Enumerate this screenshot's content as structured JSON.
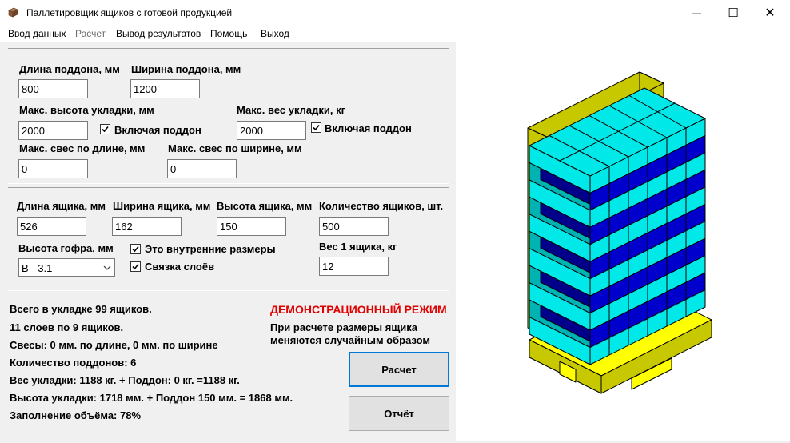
{
  "window": {
    "title": "Паллетировщик ящиков с готовой продукцией",
    "minimize_glyph": "—",
    "maximize_glyph": "☐",
    "close_glyph": "✕"
  },
  "menu": {
    "items": [
      "Ввод данных",
      "Расчет",
      "Вывод результатов",
      "Помощь",
      "Выход"
    ]
  },
  "pallet": {
    "length_label": "Длина поддона, мм",
    "length_value": "800",
    "width_label": "Ширина поддона, мм",
    "width_value": "1200",
    "max_height_label": "Макс. высота укладки, мм",
    "max_height_value": "2000",
    "height_incl_pallet_label": "Включая поддон",
    "height_incl_pallet_checked": true,
    "max_weight_label": "Макс. вес укладки, кг",
    "max_weight_value": "2000",
    "weight_incl_pallet_label": "Включая поддон",
    "weight_incl_pallet_checked": true,
    "overhang_length_label": "Макс. свес по длине, мм",
    "overhang_length_value": "0",
    "overhang_width_label": "Макс. свес по ширине, мм",
    "overhang_width_value": "0"
  },
  "box": {
    "length_label": "Длина ящика, мм",
    "length_value": "526",
    "width_label": "Ширина ящика, мм",
    "width_value": "162",
    "height_label": "Высота ящика, мм",
    "height_value": "150",
    "count_label": "Количество ящиков, шт.",
    "count_value": "500",
    "flute_label": "Высота гофра, мм",
    "flute_value": "B - 3.1",
    "internal_dims_label": "Это внутренние размеры",
    "internal_dims_checked": true,
    "layer_binding_label": "Связка слоёв",
    "layer_binding_checked": true,
    "weight_label": "Вес 1 ящика, кг",
    "weight_value": "12"
  },
  "results": {
    "lines": [
      "Всего в укладке 99 ящиков.",
      "11 слоев по 9 ящиков.",
      "Свесы: 0 мм. по длине, 0 мм. по ширине",
      "Количество поддонов: 6",
      "Вес укладки: 1188 кг. + Поддон: 0 кг. =1188 кг.",
      "Высота укладки: 1718 мм. + Поддон 150 мм. = 1868 мм.",
      "Заполнение объёма: 78%"
    ]
  },
  "demo": {
    "title": "ДЕМОНСТРАЦИОННЫЙ РЕЖИМ",
    "note_line1": "При расчете размеры ящика",
    "note_line2": "меняются случайным образом",
    "title_color": "#e00000"
  },
  "buttons": {
    "calculate": "Расчет",
    "report": "Отчёт"
  },
  "visual": {
    "layers": 11,
    "colors": {
      "pallet": "#ffff00",
      "frame": "#c8c800",
      "box_cyan": "#00e8e8",
      "box_teal": "#00b3b3",
      "box_blue": "#0000cc",
      "box_dark_blue": "#00008b",
      "outline": "#000000"
    }
  }
}
